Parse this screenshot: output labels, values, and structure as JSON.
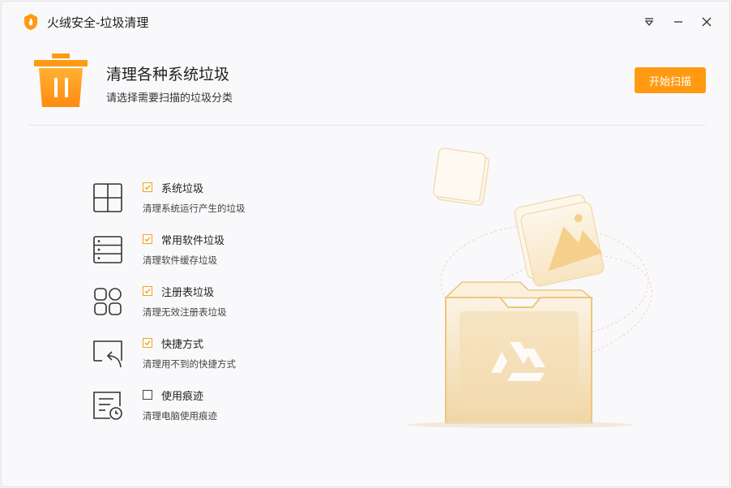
{
  "window": {
    "title": "火绒安全-垃圾清理"
  },
  "header": {
    "title": "清理各种系统垃圾",
    "subtitle": "请选择需要扫描的垃圾分类",
    "start_button": "开始扫描"
  },
  "categories": [
    {
      "label": "系统垃圾",
      "desc": "清理系统运行产生的垃圾",
      "checked": true,
      "icon": "windows-icon"
    },
    {
      "label": "常用软件垃圾",
      "desc": "清理软件缓存垃圾",
      "checked": true,
      "icon": "software-list-icon"
    },
    {
      "label": "注册表垃圾",
      "desc": "清理无效注册表垃圾",
      "checked": true,
      "icon": "registry-icon"
    },
    {
      "label": "快捷方式",
      "desc": "清理用不到的快捷方式",
      "checked": true,
      "icon": "shortcut-icon"
    },
    {
      "label": "使用痕迹",
      "desc": "清理电脑使用痕迹",
      "checked": false,
      "icon": "usage-trace-icon"
    }
  ],
  "colors": {
    "accent": "#ff9a12",
    "illustration": "#f4d9a8"
  }
}
